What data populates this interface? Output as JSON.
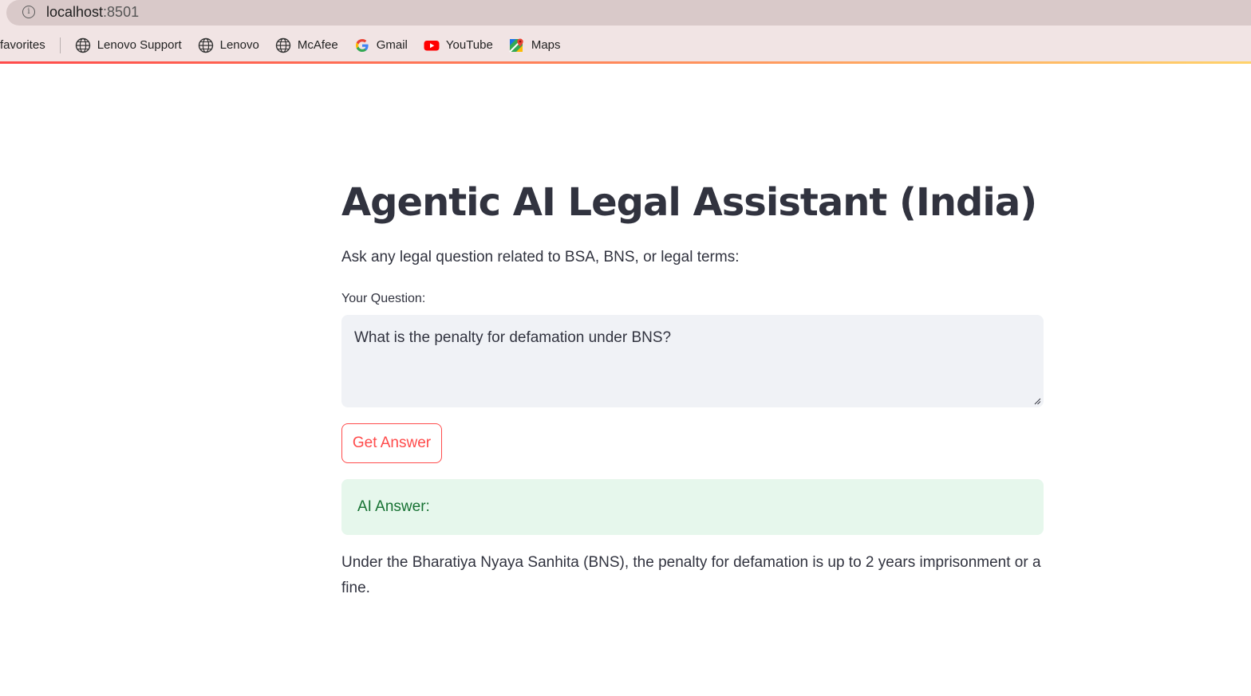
{
  "browser": {
    "url_host": "localhost",
    "url_port": ":8501",
    "bookmarks": {
      "favorites_label": "favorites",
      "items": [
        {
          "label": "Lenovo Support",
          "icon": "globe-icon"
        },
        {
          "label": "Lenovo",
          "icon": "globe-icon"
        },
        {
          "label": "McAfee",
          "icon": "globe-icon"
        },
        {
          "label": "Gmail",
          "icon": "google-icon"
        },
        {
          "label": "YouTube",
          "icon": "youtube-icon"
        },
        {
          "label": "Maps",
          "icon": "maps-icon"
        }
      ]
    }
  },
  "app": {
    "title": "Agentic AI Legal Assistant (India)",
    "subtitle": "Ask any legal question related to BSA, BNS, or legal terms:",
    "question_label": "Your Question:",
    "question_value": "What is the penalty for defamation under BNS?",
    "submit_label": "Get Answer",
    "answer_heading": "AI Answer:",
    "answer_text": "Under the Bharatiya Nyaya Sanhita (BNS), the penalty for defamation is up to 2 years imprisonment or a fine."
  },
  "colors": {
    "accent": "#ff4b4b",
    "text": "#31333f",
    "success_bg": "#e6f7ec",
    "success_text": "#177233",
    "input_bg": "#f0f2f6"
  }
}
